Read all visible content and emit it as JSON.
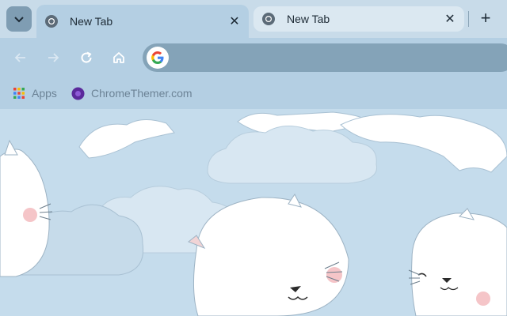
{
  "tabs": [
    {
      "title": "New Tab",
      "active": true,
      "close_icon": "close-icon"
    },
    {
      "title": "New Tab",
      "active": false,
      "close_icon": "close-icon"
    }
  ],
  "tab_search_icon": "chevron-down-icon",
  "new_tab_icon": "plus-icon",
  "toolbar": {
    "back_icon": "arrow-left-icon",
    "forward_icon": "arrow-right-icon",
    "reload_icon": "reload-icon",
    "home_icon": "home-icon",
    "search_engine_icon": "google-g-icon",
    "address_value": ""
  },
  "bookmarks": [
    {
      "label": "Apps",
      "icon": "apps-grid-icon"
    },
    {
      "label": "ChromeThemer.com",
      "icon": "chromethemer-icon"
    }
  ],
  "theme": {
    "frame_color": "#c8dbe9",
    "toolbar_color": "#b4cfe3",
    "omnibox_color": "#84a3b8",
    "background_color": "#c5dcec"
  }
}
